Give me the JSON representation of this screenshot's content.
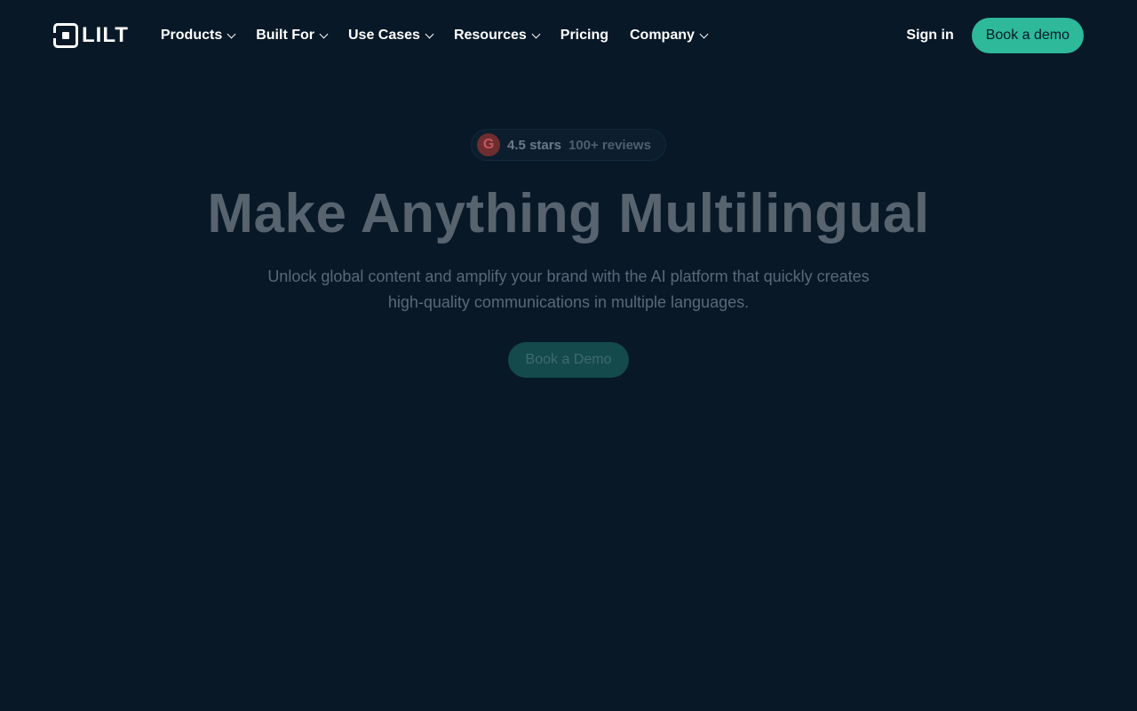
{
  "header": {
    "logo_text": "LILT",
    "nav": [
      {
        "label": "Products",
        "dropdown": true
      },
      {
        "label": "Built For",
        "dropdown": true
      },
      {
        "label": "Use Cases",
        "dropdown": true
      },
      {
        "label": "Resources",
        "dropdown": true
      },
      {
        "label": "Pricing",
        "dropdown": false
      },
      {
        "label": "Company",
        "dropdown": true
      }
    ],
    "signin_label": "Sign in",
    "cta_label": "Book a demo"
  },
  "hero": {
    "rating_icon": "G",
    "rating_stars": "4.5 stars",
    "rating_reviews": "100+ reviews",
    "headline": "Make Anything Multilingual",
    "subtitle": "Unlock global content and amplify your brand with the AI platform that quickly creates high-quality communications in multiple languages.",
    "cta_label": "Book a Demo"
  },
  "colors": {
    "background": "#081827",
    "accent": "#2db99a",
    "headline": "#57636f"
  },
  "icons": {
    "logo": "lilt-logo-icon",
    "rating": "g2-icon",
    "dropdown": "chevron-down-icon"
  }
}
